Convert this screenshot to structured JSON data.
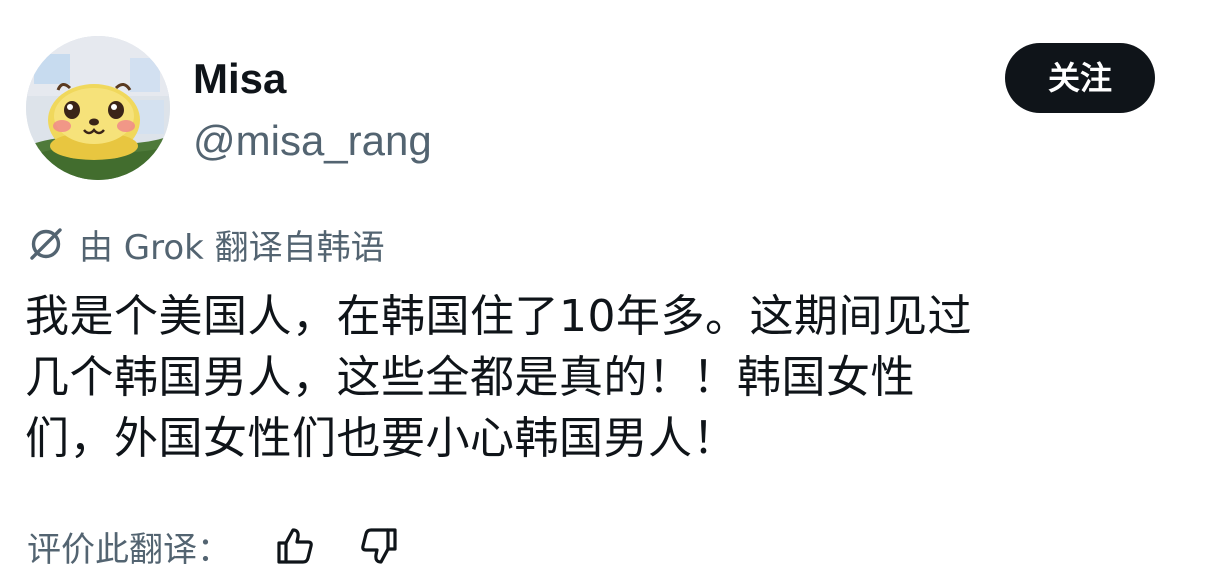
{
  "user": {
    "display_name": "Misa",
    "handle": "@misa_rang",
    "avatar_icon": "avatar-cartoon-face"
  },
  "follow_button": {
    "label": "关注"
  },
  "translation": {
    "note": "由 Grok 翻译自韩语",
    "icon": "grok-icon"
  },
  "tweet": {
    "lines": [
      "我是个美国人，在韩国住了10年多。这期间见过",
      "几个韩国男人，这些全都是真的！！韩国女性",
      "们，外国女性们也要小心韩国男人！"
    ]
  },
  "rating": {
    "label": "评价此翻译：",
    "up_icon": "thumbs-up-icon",
    "down_icon": "thumbs-down-icon"
  },
  "colors": {
    "text_primary": "#0f1419",
    "text_secondary": "#536471",
    "button_bg": "#0f1419",
    "button_text": "#ffffff",
    "background": "#ffffff"
  }
}
